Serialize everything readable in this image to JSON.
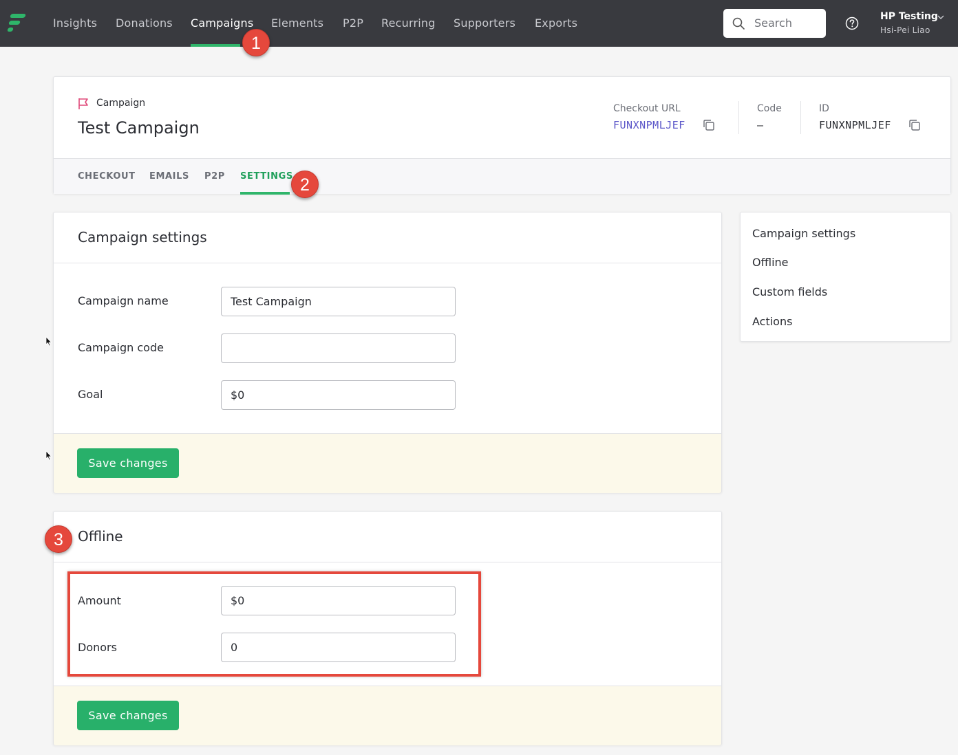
{
  "topbar": {
    "nav": [
      "Insights",
      "Donations",
      "Campaigns",
      "Elements",
      "P2P",
      "Recurring",
      "Supporters",
      "Exports"
    ],
    "active_nav": "Campaigns",
    "search_placeholder": "Search",
    "org_name": "HP Testing",
    "user_name": "Hsi-Pei Liao"
  },
  "badges": [
    "1",
    "2",
    "3"
  ],
  "header": {
    "kind_label": "Campaign",
    "title": "Test Campaign",
    "checkout_url_label": "Checkout URL",
    "checkout_url_value": "FUNXNPMLJEF",
    "code_label": "Code",
    "code_value": "—",
    "id_label": "ID",
    "id_value": "FUNXNPMLJEF",
    "tabs": [
      "CHECKOUT",
      "EMAILS",
      "P2P",
      "SETTINGS"
    ],
    "active_tab": "SETTINGS"
  },
  "campaign_settings": {
    "title": "Campaign settings",
    "fields": [
      {
        "label": "Campaign name",
        "value": "Test Campaign"
      },
      {
        "label": "Campaign code",
        "value": ""
      },
      {
        "label": "Goal",
        "value": "$0"
      }
    ],
    "save_label": "Save changes"
  },
  "offline": {
    "title": "Offline",
    "fields": [
      {
        "label": "Amount",
        "value": "$0"
      },
      {
        "label": "Donors",
        "value": "0"
      }
    ],
    "save_label": "Save changes"
  },
  "side_nav": [
    "Campaign settings",
    "Offline",
    "Custom fields",
    "Actions"
  ],
  "colors": {
    "accent": "#2fb56a",
    "link": "#5a55c8",
    "annotation": "#e5483c",
    "topbar": "#393a3f",
    "footer": "#fcf9ea"
  },
  "icons": [
    "logo",
    "search-icon",
    "help-icon",
    "chevron-down-icon",
    "flag-icon",
    "copy-icon"
  ]
}
